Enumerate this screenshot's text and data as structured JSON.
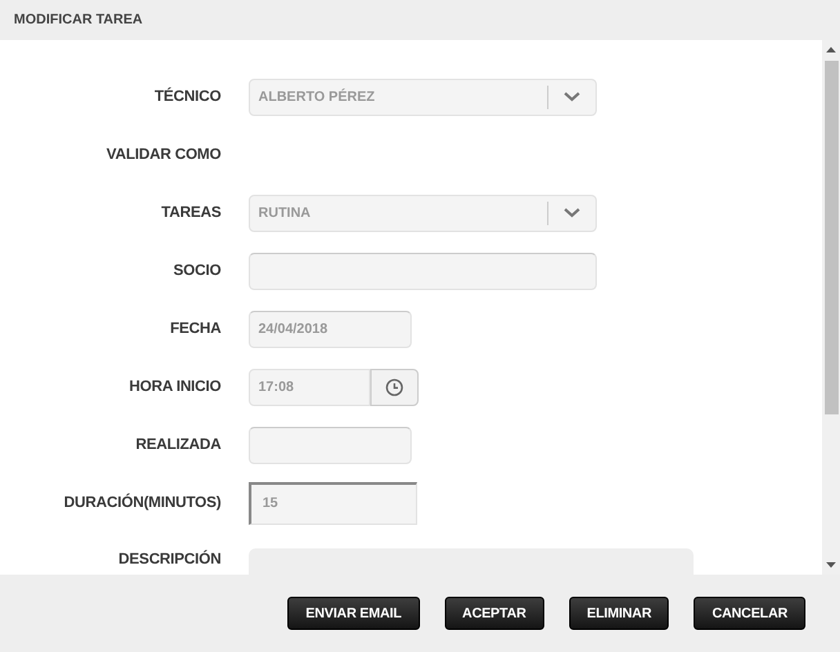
{
  "window": {
    "title": "MODIFICAR TAREA"
  },
  "fields": [
    {
      "label": "TÉCNICO",
      "kind": "select",
      "value": "ALBERTO PÉREZ"
    },
    {
      "label": "VALIDAR COMO",
      "kind": "none"
    },
    {
      "label": "TAREAS",
      "kind": "select",
      "value": "RUTINA"
    },
    {
      "label": "SOCIO",
      "kind": "text"
    },
    {
      "label": "FECHA",
      "kind": "short",
      "value": "24/04/2018"
    },
    {
      "label": "HORA INICIO",
      "kind": "time",
      "value": "17:08"
    },
    {
      "label": "REALIZADA",
      "kind": "short"
    },
    {
      "label": "DURACIÓN(MINUTOS)",
      "kind": "number",
      "value": "15"
    },
    {
      "label": "DESCRIPCIÓN",
      "kind": "textarea"
    }
  ],
  "buttons": [
    "ENVIAR EMAIL",
    "ACEPTAR",
    "ELIMINAR",
    "CANCELAR"
  ]
}
